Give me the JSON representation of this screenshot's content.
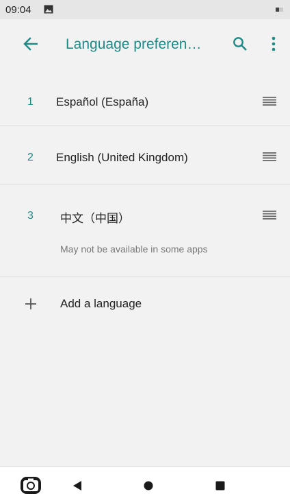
{
  "status_bar": {
    "time": "09:04",
    "photo_icon": "image-icon",
    "battery_icon": "battery-icon"
  },
  "app_bar": {
    "title": "Language preferen…",
    "back_icon": "arrow-left-icon",
    "search_icon": "search-icon",
    "more_icon": "more-vert-icon",
    "accent_color": "#1f8a86"
  },
  "languages": [
    {
      "number": "1",
      "name": "Español (España)",
      "note": ""
    },
    {
      "number": "2",
      "name": "English (United Kingdom)",
      "note": ""
    },
    {
      "number": "3",
      "name": "中文（中国）",
      "note": "May not be available in some apps"
    }
  ],
  "add_language": {
    "label": "Add a language",
    "icon": "plus-icon"
  },
  "nav_bar": {
    "camera_icon": "camera-icon",
    "back_icon": "triangle-back-icon",
    "home_icon": "circle-home-icon",
    "recents_icon": "square-recents-icon"
  }
}
